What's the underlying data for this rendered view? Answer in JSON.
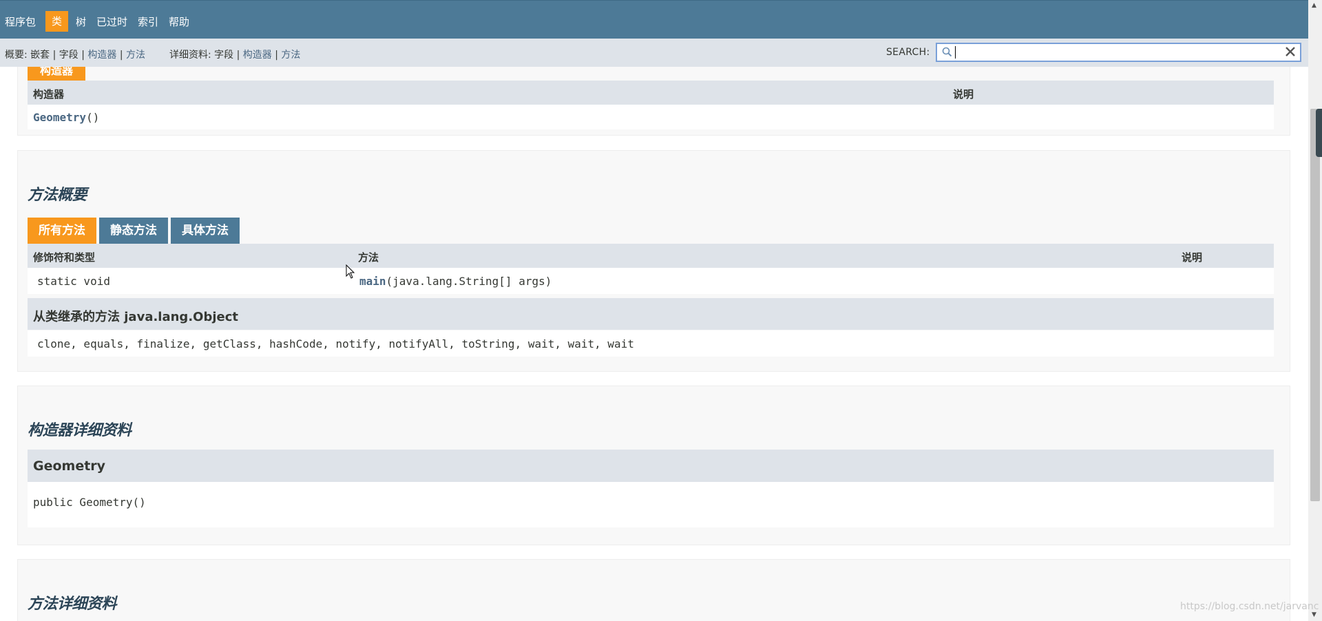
{
  "top_nav": {
    "items": [
      "程序包",
      "类",
      "树",
      "已过时",
      "索引",
      "帮助"
    ],
    "active_item": "类"
  },
  "sub_nav": {
    "summary_label": "概要:",
    "summary_nested": "嵌套",
    "summary_field": "字段",
    "summary_constructor": "构造器",
    "summary_method": "方法",
    "detail_label": "详细资料:",
    "detail_field": "字段",
    "detail_constructor": "构造器",
    "detail_method": "方法",
    "separator": "|"
  },
  "search": {
    "label": "SEARCH:",
    "value": ""
  },
  "constructor_summary": {
    "caption": "构造器",
    "columns": [
      "构造器",
      "说明"
    ],
    "rows": [
      {
        "name": "Geometry",
        "suffix": "()"
      }
    ]
  },
  "method_summary": {
    "heading": "方法概要",
    "tabs": [
      "所有方法",
      "静态方法",
      "具体方法"
    ],
    "active_tab": "所有方法",
    "columns": [
      "修饰符和类型",
      "方法",
      "说明"
    ],
    "rows": [
      {
        "modifier": "static void",
        "name": "main",
        "params": "(java.lang.String[] args)"
      }
    ],
    "inherited_heading": "从类继承的方法 java.lang.Object",
    "inherited_methods": "clone, equals, finalize, getClass, hashCode, notify, notifyAll, toString, wait, wait, wait"
  },
  "constructor_detail": {
    "heading": "构造器详细资料",
    "member_name": "Geometry",
    "signature": "public Geometry()"
  },
  "method_detail": {
    "heading": "方法详细资料"
  },
  "watermark": "https://blog.csdn.net/jarvanc",
  "colors": {
    "nav_bar": "#4d7a97",
    "active_orange": "#f8981d",
    "sub_nav": "#dee3e9",
    "link": "#4a6782",
    "heading": "#2c4557"
  }
}
